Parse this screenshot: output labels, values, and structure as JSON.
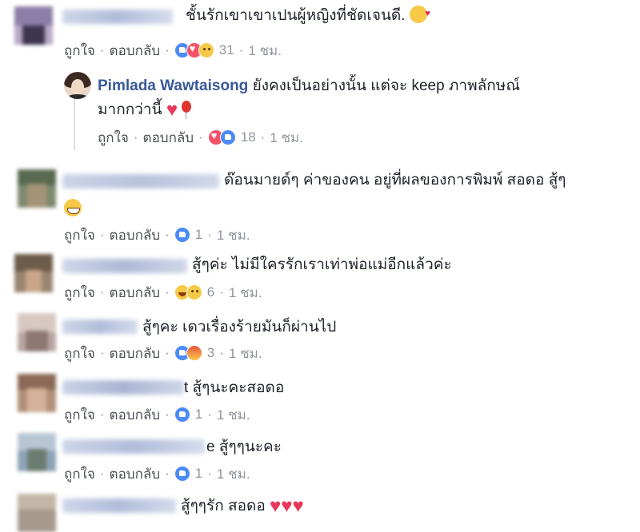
{
  "labels": {
    "like": "ถูกใจ",
    "reply": "ตอบกลับ",
    "sep": "·"
  },
  "comments": [
    {
      "text": "ชั้นรักเขาเขาเปนผู้หญิงที่ชัดเจนดี.",
      "count": "31",
      "time": "1 ชม.",
      "reactions": [
        "like-icon",
        "love-icon",
        "sad-icon"
      ],
      "trailing_emoji": "kiss-face-emoji"
    },
    {
      "author": "Pimlada Wawtaisong",
      "text_line1": "ยังคงเป็นอย่างนั้น แต่จะ keep ภาพลักษณ์",
      "text_line2": "มากกว่านี้",
      "count": "18",
      "time": "1 ชม.",
      "reactions": [
        "love-icon",
        "like-icon"
      ],
      "trailing_emoji": [
        "heart-emoji",
        "balloon-emoji"
      ]
    },
    {
      "text": "ด๊อนมายด์ๆ ค่าของคน อยู่ที่ผลของการพิมพ์ สอดอ สู้ๆ",
      "count": "1",
      "time": "1 ชม.",
      "reactions": [
        "like-icon"
      ],
      "trailing_emoji": "grinning-face-emoji"
    },
    {
      "text": "สู้ๆค่ะ ไม่มีใครรักเราเท่าพ่อแม่อีกแล้วค่ะ",
      "count": "6",
      "time": "1 ชม.",
      "reactions": [
        "haha-icon",
        "sad-icon"
      ]
    },
    {
      "text": "สู้ๆคะ เดวเรื่องร้ายมันก็ผ่านไป",
      "count": "3",
      "time": "1 ชม.",
      "reactions": [
        "like-icon",
        "angry-icon"
      ]
    },
    {
      "text": "t สู้ๆนะคะสอดอ",
      "count": "1",
      "time": "1 ชม.",
      "reactions": [
        "like-icon"
      ]
    },
    {
      "text": "e สู้ๆๆนะคะ",
      "count": "1",
      "time": "1 ชม.",
      "reactions": [
        "like-icon"
      ]
    },
    {
      "text": "สู้ๆๆรัก สอดอ",
      "trailing_emoji": [
        "heart-emoji",
        "heart-emoji",
        "heart-emoji"
      ]
    }
  ],
  "colors": {
    "link": "#385898",
    "meta": "#90949c",
    "action": "#4b4f56",
    "text": "#1d2129"
  }
}
